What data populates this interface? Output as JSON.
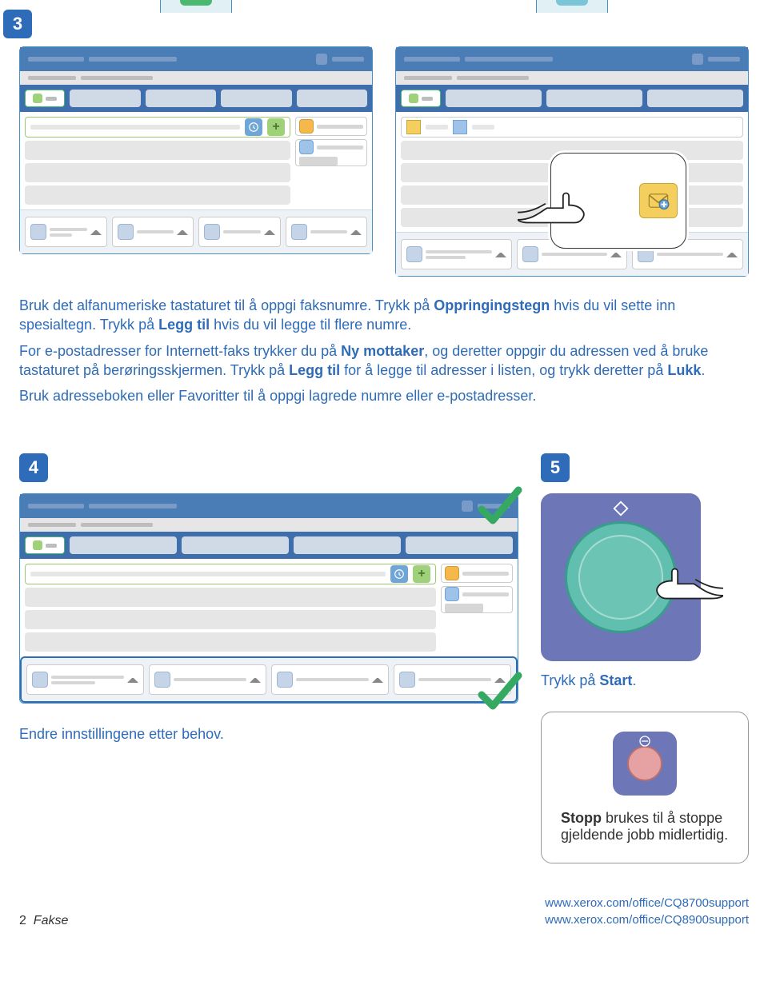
{
  "step3": {
    "number": "3"
  },
  "step4": {
    "number": "4"
  },
  "step5": {
    "number": "5"
  },
  "instruction": {
    "line1_a": "Bruk det alfanumeriske tastaturet til å oppgi faksnumre. Trykk på ",
    "line1_b": "Oppringingstegn",
    "line1_c": " hvis du vil sette inn spesialtegn. Trykk på ",
    "line1_d": "Legg til",
    "line1_e": " hvis du vil legge til flere numre.",
    "line2_a": "For e-postadresser for Internett-faks trykker du på ",
    "line2_b": "Ny mottaker",
    "line2_c": ", og deretter oppgir du adressen ved å bruke tastaturet på berøringsskjermen. Trykk på ",
    "line2_d": "Legg til",
    "line2_e": " for å legge til adresser i listen, og trykk deretter på ",
    "line2_f": "Lukk",
    "line2_g": ".",
    "line3": "Bruk adresseboken eller Favoritter til å oppgi lagrede numre eller e-postadresser."
  },
  "step4_caption": "Endre innstillingene etter behov.",
  "step5_caption_a": "Trykk på ",
  "step5_caption_b": "Start",
  "step5_caption_c": ".",
  "stop_caption_a": "Stopp",
  "stop_caption_b": " brukes til å stoppe gjeldende jobb midlertidig.",
  "footer": {
    "page_number": "2",
    "doc_title": "Fakse",
    "url1": "www.xerox.com/office/CQ8700support",
    "url2": "www.xerox.com/office/CQ8900support"
  }
}
